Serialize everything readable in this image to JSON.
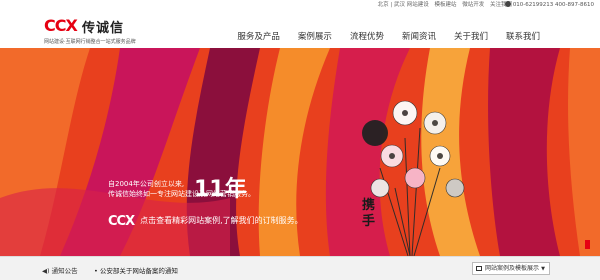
{
  "topbar": {
    "links": [
      "北京 | 武汉 网站建设",
      "模板建站",
      "微站开发",
      "关注我们"
    ],
    "phone": "010-62199213 400-897-8610"
  },
  "logo": {
    "mark": "CCX",
    "name": "传诚信",
    "tagline": "网站建设·互联网行销整合一站式服务品牌"
  },
  "nav": [
    "服务及产品",
    "案例展示",
    "流程优势",
    "新闻资讯",
    "关于我们",
    "联系我们"
  ],
  "banner": {
    "line1": "自2004年公司创立以来,",
    "line2": "传诚信始终如一专注网站建设及网络营销服务。",
    "big": "11年",
    "ccx": "CCX",
    "cta": "点击查看精彩网站案例,了解我们的订制服务。",
    "calligraphy": "携手"
  },
  "notice": {
    "label": "通知公告",
    "text": "公安部关于网站备案的通知"
  },
  "case_button": "网站案例及模板展示",
  "colors": {
    "brand_red": "#e60012",
    "banner_orange": "#e83a1f"
  }
}
